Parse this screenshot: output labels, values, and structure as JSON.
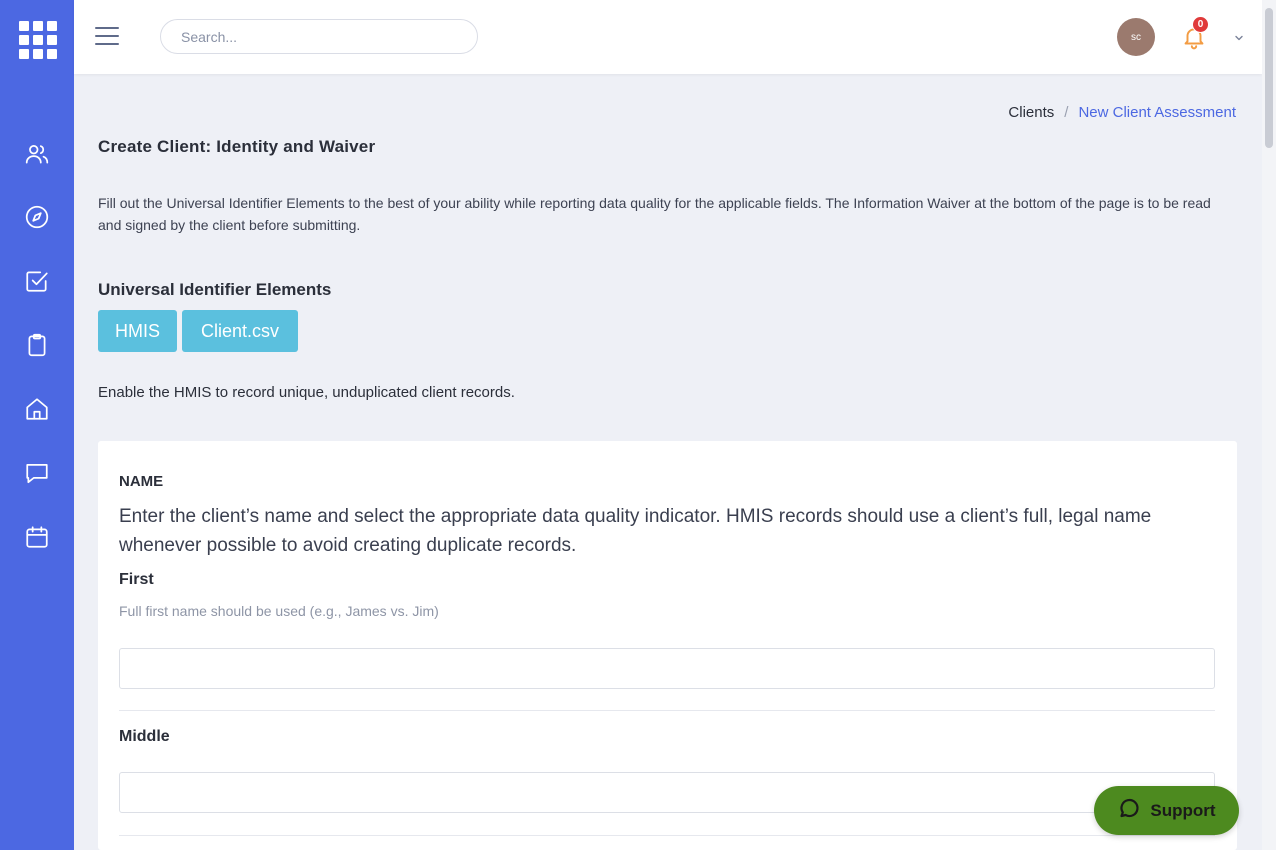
{
  "topbar": {
    "search_placeholder": "Search...",
    "avatar_initials": "sc",
    "notification_count": "0"
  },
  "sidebar": {
    "items": [
      {
        "icon": "users-icon"
      },
      {
        "icon": "compass-icon"
      },
      {
        "icon": "checkbox-icon"
      },
      {
        "icon": "clipboard-icon"
      },
      {
        "icon": "home-icon"
      },
      {
        "icon": "chat-icon"
      },
      {
        "icon": "calendar-icon"
      }
    ]
  },
  "breadcrumb": {
    "parent": "Clients",
    "separator": "/",
    "current": "New Client Assessment"
  },
  "page": {
    "title": "Create Client: Identity and Waiver",
    "intro": "Fill out the Universal Identifier Elements to the best of your ability while reporting data quality for the applicable fields. The Information Waiver at the bottom of the page is to be read and signed by the client before submitting.",
    "section_title": "Universal Identifier Elements",
    "tags": [
      "HMIS",
      "Client.csv"
    ],
    "enable_text": "Enable the HMIS to record unique, unduplicated client records."
  },
  "name_card": {
    "heading": "NAME",
    "description": "Enter the client’s name and select the appropriate data quality indicator. HMIS records should use a client’s full, legal name whenever possible to avoid creating duplicate records.",
    "first_label": "First",
    "first_hint": "Full first name should be used (e.g., James vs. Jim)",
    "first_value": "",
    "middle_label": "Middle",
    "middle_value": ""
  },
  "support": {
    "label": "Support"
  },
  "colors": {
    "sidebar": "#4c68e2",
    "accent": "#4c68e2",
    "tag": "#5bc0de",
    "support": "#4d8a1f",
    "badge": "#e03a3a",
    "bell": "#f39c43"
  }
}
